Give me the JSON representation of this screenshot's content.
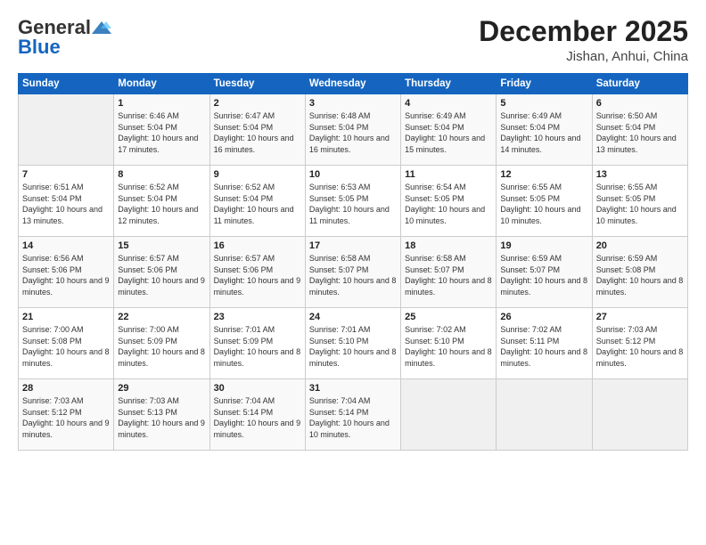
{
  "header": {
    "logo_general": "General",
    "logo_blue": "Blue",
    "title": "December 2025",
    "location": "Jishan, Anhui, China"
  },
  "columns": [
    "Sunday",
    "Monday",
    "Tuesday",
    "Wednesday",
    "Thursday",
    "Friday",
    "Saturday"
  ],
  "weeks": [
    [
      {
        "day": "",
        "info": ""
      },
      {
        "day": "1",
        "info": "Sunrise: 6:46 AM\nSunset: 5:04 PM\nDaylight: 10 hours\nand 17 minutes."
      },
      {
        "day": "2",
        "info": "Sunrise: 6:47 AM\nSunset: 5:04 PM\nDaylight: 10 hours\nand 16 minutes."
      },
      {
        "day": "3",
        "info": "Sunrise: 6:48 AM\nSunset: 5:04 PM\nDaylight: 10 hours\nand 16 minutes."
      },
      {
        "day": "4",
        "info": "Sunrise: 6:49 AM\nSunset: 5:04 PM\nDaylight: 10 hours\nand 15 minutes."
      },
      {
        "day": "5",
        "info": "Sunrise: 6:49 AM\nSunset: 5:04 PM\nDaylight: 10 hours\nand 14 minutes."
      },
      {
        "day": "6",
        "info": "Sunrise: 6:50 AM\nSunset: 5:04 PM\nDaylight: 10 hours\nand 13 minutes."
      }
    ],
    [
      {
        "day": "7",
        "info": "Sunrise: 6:51 AM\nSunset: 5:04 PM\nDaylight: 10 hours\nand 13 minutes."
      },
      {
        "day": "8",
        "info": "Sunrise: 6:52 AM\nSunset: 5:04 PM\nDaylight: 10 hours\nand 12 minutes."
      },
      {
        "day": "9",
        "info": "Sunrise: 6:52 AM\nSunset: 5:04 PM\nDaylight: 10 hours\nand 11 minutes."
      },
      {
        "day": "10",
        "info": "Sunrise: 6:53 AM\nSunset: 5:05 PM\nDaylight: 10 hours\nand 11 minutes."
      },
      {
        "day": "11",
        "info": "Sunrise: 6:54 AM\nSunset: 5:05 PM\nDaylight: 10 hours\nand 10 minutes."
      },
      {
        "day": "12",
        "info": "Sunrise: 6:55 AM\nSunset: 5:05 PM\nDaylight: 10 hours\nand 10 minutes."
      },
      {
        "day": "13",
        "info": "Sunrise: 6:55 AM\nSunset: 5:05 PM\nDaylight: 10 hours\nand 10 minutes."
      }
    ],
    [
      {
        "day": "14",
        "info": "Sunrise: 6:56 AM\nSunset: 5:06 PM\nDaylight: 10 hours\nand 9 minutes."
      },
      {
        "day": "15",
        "info": "Sunrise: 6:57 AM\nSunset: 5:06 PM\nDaylight: 10 hours\nand 9 minutes."
      },
      {
        "day": "16",
        "info": "Sunrise: 6:57 AM\nSunset: 5:06 PM\nDaylight: 10 hours\nand 9 minutes."
      },
      {
        "day": "17",
        "info": "Sunrise: 6:58 AM\nSunset: 5:07 PM\nDaylight: 10 hours\nand 8 minutes."
      },
      {
        "day": "18",
        "info": "Sunrise: 6:58 AM\nSunset: 5:07 PM\nDaylight: 10 hours\nand 8 minutes."
      },
      {
        "day": "19",
        "info": "Sunrise: 6:59 AM\nSunset: 5:07 PM\nDaylight: 10 hours\nand 8 minutes."
      },
      {
        "day": "20",
        "info": "Sunrise: 6:59 AM\nSunset: 5:08 PM\nDaylight: 10 hours\nand 8 minutes."
      }
    ],
    [
      {
        "day": "21",
        "info": "Sunrise: 7:00 AM\nSunset: 5:08 PM\nDaylight: 10 hours\nand 8 minutes."
      },
      {
        "day": "22",
        "info": "Sunrise: 7:00 AM\nSunset: 5:09 PM\nDaylight: 10 hours\nand 8 minutes."
      },
      {
        "day": "23",
        "info": "Sunrise: 7:01 AM\nSunset: 5:09 PM\nDaylight: 10 hours\nand 8 minutes."
      },
      {
        "day": "24",
        "info": "Sunrise: 7:01 AM\nSunset: 5:10 PM\nDaylight: 10 hours\nand 8 minutes."
      },
      {
        "day": "25",
        "info": "Sunrise: 7:02 AM\nSunset: 5:10 PM\nDaylight: 10 hours\nand 8 minutes."
      },
      {
        "day": "26",
        "info": "Sunrise: 7:02 AM\nSunset: 5:11 PM\nDaylight: 10 hours\nand 8 minutes."
      },
      {
        "day": "27",
        "info": "Sunrise: 7:03 AM\nSunset: 5:12 PM\nDaylight: 10 hours\nand 8 minutes."
      }
    ],
    [
      {
        "day": "28",
        "info": "Sunrise: 7:03 AM\nSunset: 5:12 PM\nDaylight: 10 hours\nand 9 minutes."
      },
      {
        "day": "29",
        "info": "Sunrise: 7:03 AM\nSunset: 5:13 PM\nDaylight: 10 hours\nand 9 minutes."
      },
      {
        "day": "30",
        "info": "Sunrise: 7:04 AM\nSunset: 5:14 PM\nDaylight: 10 hours\nand 9 minutes."
      },
      {
        "day": "31",
        "info": "Sunrise: 7:04 AM\nSunset: 5:14 PM\nDaylight: 10 hours\nand 10 minutes."
      },
      {
        "day": "",
        "info": ""
      },
      {
        "day": "",
        "info": ""
      },
      {
        "day": "",
        "info": ""
      }
    ]
  ]
}
